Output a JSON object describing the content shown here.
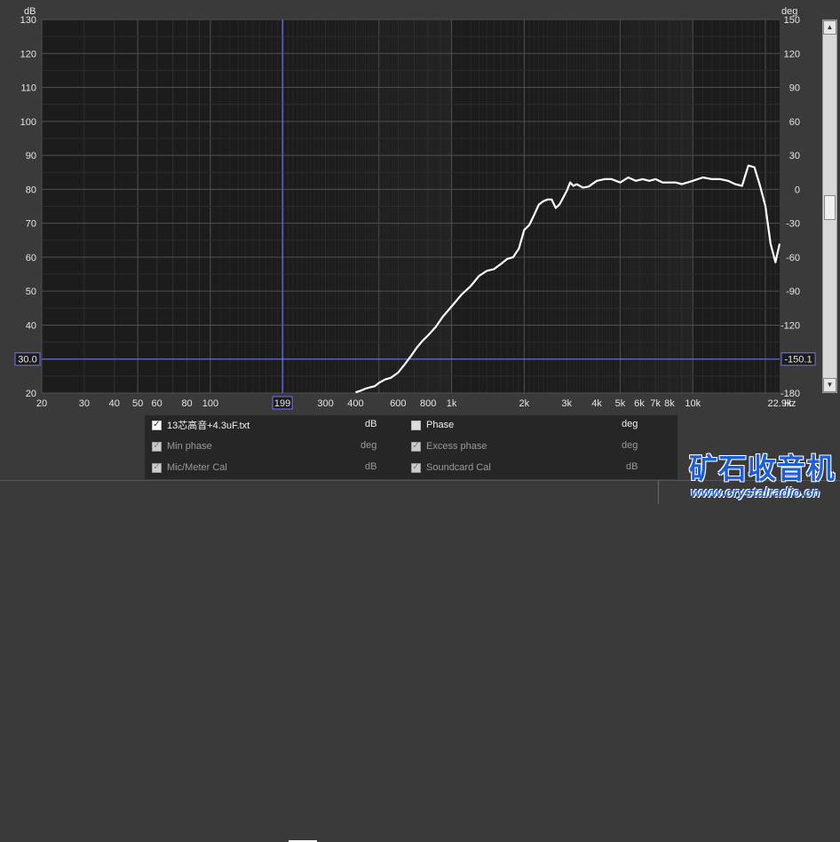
{
  "chart_data": {
    "type": "line",
    "y_left_unit": "dB",
    "y_right_unit": "deg",
    "x_unit": "Hz",
    "x_scale": "log",
    "xlim": [
      20,
      22900
    ],
    "ylim": [
      20,
      130
    ],
    "ylim_right": [
      -180,
      150
    ],
    "x_ticks": [
      "20",
      "30",
      "40",
      "50",
      "60",
      "80",
      "100",
      "300",
      "400",
      "600",
      "800",
      "1k",
      "2k",
      "3k",
      "4k",
      "5k",
      "6k",
      "7k",
      "8k",
      "10k",
      "22.9k"
    ],
    "y_ticks": [
      "20",
      "30",
      "40",
      "50",
      "60",
      "70",
      "80",
      "90",
      "100",
      "110",
      "120",
      "130"
    ],
    "y_right_ticks": [
      "-180",
      "-150",
      "-120",
      "-90",
      "-60",
      "-30",
      "0",
      "30",
      "60",
      "90",
      "120",
      "150"
    ],
    "cursor_x_label": "199",
    "cursor_y_label": "30.0",
    "cursor_y_right_label": "-150.1",
    "grid": true,
    "series": [
      {
        "name": "13芯高音+4.3uF.txt",
        "color": "#ffffff",
        "x": [
          400,
          420,
          440,
          460,
          480,
          500,
          530,
          560,
          600,
          640,
          680,
          720,
          760,
          800,
          860,
          920,
          1000,
          1100,
          1200,
          1300,
          1400,
          1500,
          1600,
          1700,
          1800,
          1900,
          2000,
          2100,
          2200,
          2300,
          2400,
          2500,
          2600,
          2700,
          2800,
          2900,
          3000,
          3100,
          3200,
          3300,
          3500,
          3700,
          4000,
          4300,
          4600,
          5000,
          5400,
          5800,
          6200,
          6600,
          7000,
          7500,
          8000,
          8500,
          9000,
          9500,
          10000,
          11000,
          12000,
          13000,
          14000,
          15000,
          16000,
          17000,
          18000,
          19000,
          20000,
          21000,
          22000,
          22900
        ],
        "values": [
          20.2,
          20.7,
          21.3,
          21.7,
          22.0,
          23.0,
          24.0,
          24.5,
          26.0,
          28.5,
          31.0,
          33.5,
          35.5,
          37.0,
          39.5,
          42.5,
          45.5,
          49.0,
          51.5,
          54.5,
          56.0,
          56.5,
          58.0,
          59.5,
          60.0,
          62.5,
          68.0,
          69.5,
          72.5,
          75.5,
          76.5,
          77.0,
          77.0,
          74.5,
          75.5,
          77.5,
          79.5,
          82.0,
          81.0,
          81.5,
          80.5,
          80.8,
          82.5,
          83.0,
          83.0,
          82.0,
          83.5,
          82.5,
          83.0,
          82.5,
          83.0,
          82.0,
          82.0,
          82.0,
          81.5,
          82.0,
          82.5,
          83.5,
          83.0,
          83.0,
          82.5,
          81.5,
          81.0,
          87.0,
          86.5,
          81.0,
          75.0,
          64.0,
          58.5,
          64.0
        ]
      }
    ]
  },
  "legend": {
    "row1": {
      "label": "13芯高音+4.3uF.txt",
      "unit": "dB",
      "check": "✓"
    },
    "row2": {
      "label": "Min phase",
      "unit": "deg",
      "check": "✓"
    },
    "row3": {
      "label": "Mic/Meter Cal",
      "unit": "dB",
      "check": "✓"
    },
    "row4": {
      "label": "Phase",
      "unit": "deg",
      "check": ""
    },
    "row5": {
      "label": "Excess phase",
      "unit": "deg",
      "check": "✓"
    },
    "row6": {
      "label": "Soundcard Cal",
      "unit": "dB",
      "check": "✓"
    }
  },
  "watermark": {
    "title": "矿石收音机",
    "url": "www.crystalradio.cn"
  },
  "colors": {
    "trace": "#ffffff",
    "cursor": "#7070ff",
    "plot_bg": "#1c1c1c",
    "grid_major": "#555555",
    "grid_minor": "#2e2e2e"
  }
}
